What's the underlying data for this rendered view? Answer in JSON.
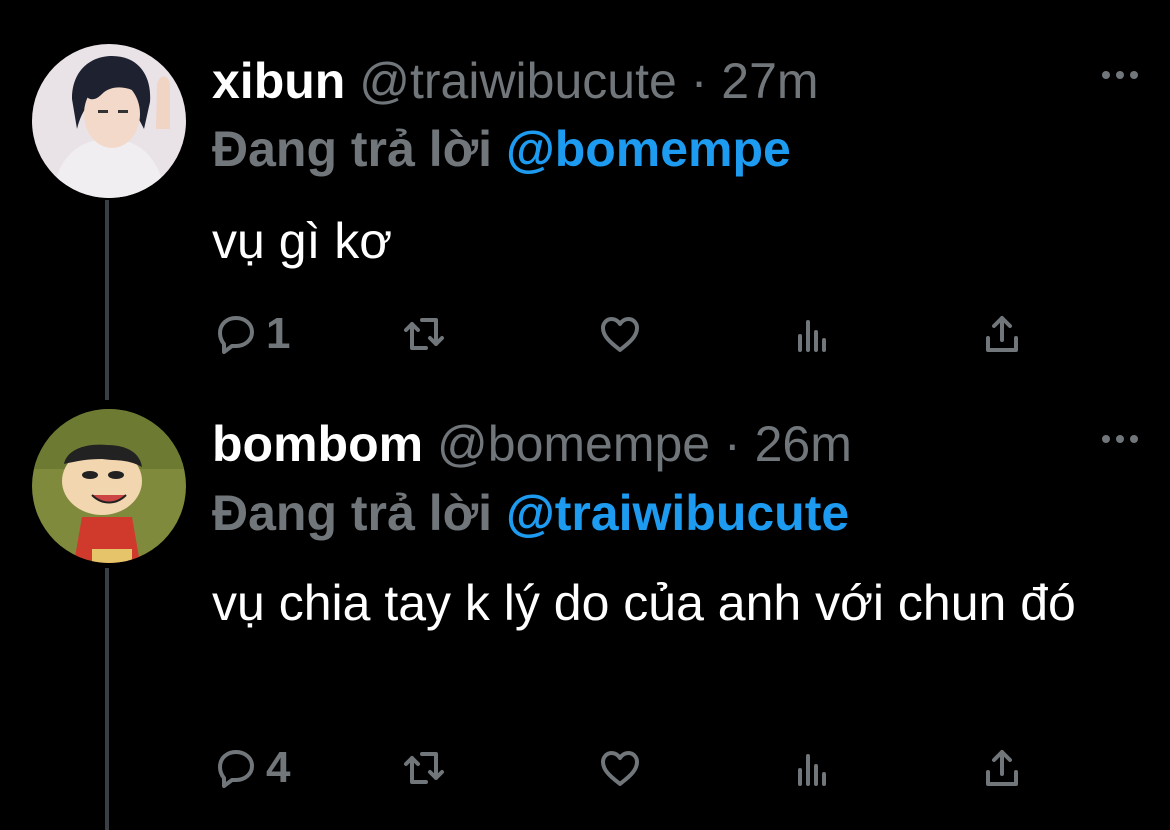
{
  "tweets": [
    {
      "name": "xibun",
      "handle": "@traiwibucute",
      "separator": "·",
      "time": "27m",
      "reply_prefix": "Đang trả lời",
      "reply_to": "@bomempe",
      "text": "vụ gì kơ",
      "reply_count": "1",
      "avatar_icon": "anime-avatar-icon"
    },
    {
      "name": "bombom",
      "handle": "@bomempe",
      "separator": "·",
      "time": "26m",
      "reply_prefix": "Đang trả lời",
      "reply_to": "@traiwibucute",
      "text": "vụ chia tay k lý do của anh với chun đó",
      "reply_count": "4",
      "avatar_icon": "cartoon-avatar-icon"
    }
  ],
  "colors": {
    "background": "#000000",
    "secondary": "#71767b",
    "accent": "#1d9bf0"
  }
}
